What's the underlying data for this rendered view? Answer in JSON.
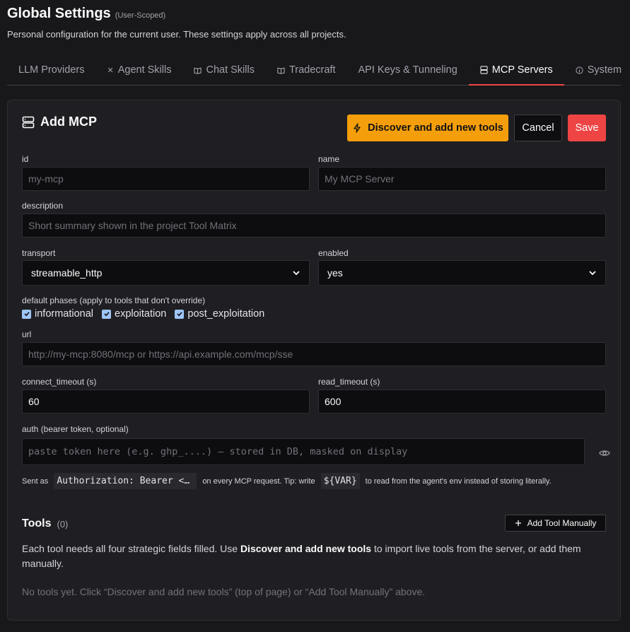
{
  "header": {
    "title": "Global Settings",
    "scope": "(User-Scoped)",
    "subtitle": "Personal configuration for the current user. These settings apply across all projects."
  },
  "tabs": [
    {
      "label": "LLM Providers",
      "icon": "none",
      "active": false
    },
    {
      "label": "Agent Skills",
      "icon": "crossed-tools-icon",
      "active": false
    },
    {
      "label": "Chat Skills",
      "icon": "book-icon",
      "active": false
    },
    {
      "label": "Tradecraft",
      "icon": "book-icon",
      "active": false
    },
    {
      "label": "API Keys & Tunneling",
      "icon": "none",
      "active": false
    },
    {
      "label": "MCP Servers",
      "icon": "server-icon",
      "active": true
    },
    {
      "label": "System",
      "icon": "info-icon",
      "active": false
    }
  ],
  "form": {
    "title": "Add MCP",
    "discover_label": "Discover and add new tools",
    "cancel_label": "Cancel",
    "save_label": "Save",
    "id": {
      "label": "id",
      "value": "",
      "placeholder": "my-mcp"
    },
    "name": {
      "label": "name",
      "value": "",
      "placeholder": "My MCP Server"
    },
    "description": {
      "label": "description",
      "value": "",
      "placeholder": "Short summary shown in the project Tool Matrix"
    },
    "transport": {
      "label": "transport",
      "value": "streamable_http"
    },
    "enabled": {
      "label": "enabled",
      "value": "yes"
    },
    "phases": {
      "label": "default phases (apply to tools that don't override)",
      "options": [
        {
          "label": "informational",
          "checked": true
        },
        {
          "label": "exploitation",
          "checked": true
        },
        {
          "label": "post_exploitation",
          "checked": true
        }
      ]
    },
    "url": {
      "label": "url",
      "value": "",
      "placeholder": "http://my-mcp:8080/mcp or https://api.example.com/mcp/sse"
    },
    "connect_timeout": {
      "label": "connect_timeout (s)",
      "value": "60"
    },
    "read_timeout": {
      "label": "read_timeout (s)",
      "value": "600"
    },
    "auth": {
      "label": "auth (bearer token, optional)",
      "value": "",
      "placeholder": "paste token here (e.g. ghp_....) — stored in DB, masked on display"
    },
    "hint": {
      "prefix": "Sent as",
      "code1": "Authorization: Bearer <token>",
      "middle": "on every MCP request. Tip: write",
      "code2": "${VAR}",
      "suffix": "to read from the agent's env instead of storing literally."
    }
  },
  "tools": {
    "title": "Tools",
    "count": "(0)",
    "add_label": "Add Tool Manually",
    "desc_pre": "Each tool needs all four strategic fields filled. Use ",
    "desc_bold": "Discover and add new tools",
    "desc_post": " to import live tools from the server, or add them manually.",
    "empty": "No tools yet. Click “Discover and add new tools” (top of page) or “Add Tool Manually” above."
  },
  "colors": {
    "accent": "#ef4444",
    "discover": "#f59e0b",
    "checkbox": "#9ec5f8"
  }
}
